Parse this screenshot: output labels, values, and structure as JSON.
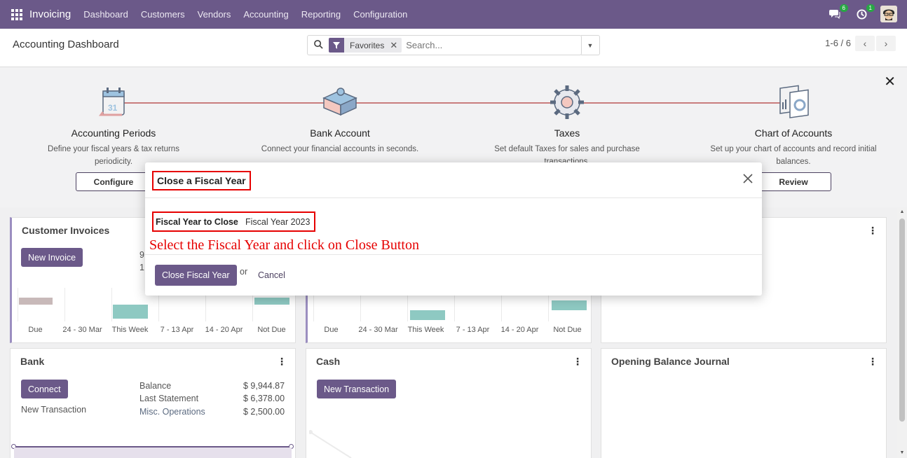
{
  "navbar": {
    "app_name": "Invoicing",
    "menu": [
      "Dashboard",
      "Customers",
      "Vendors",
      "Accounting",
      "Reporting",
      "Configuration"
    ],
    "messages_count": "6",
    "activities_count": "1"
  },
  "control": {
    "title": "Accounting Dashboard",
    "facet_label": "Favorites",
    "search_placeholder": "Search...",
    "pager": "1-6 / 6"
  },
  "onboarding": {
    "steps": [
      {
        "title": "Accounting Periods",
        "desc": "Define your fiscal years & tax returns periodicity.",
        "button": "Configure"
      },
      {
        "title": "Bank Account",
        "desc": "Connect your financial accounts in seconds."
      },
      {
        "title": "Taxes",
        "desc": "Set default Taxes for sales and purchase transactions."
      },
      {
        "title": "Chart of Accounts",
        "desc": "Set up your chart of accounts and record initial balances.",
        "button": "Review"
      }
    ]
  },
  "cards": {
    "customer_invoices": {
      "title": "Customer Invoices",
      "button": "New Invoice",
      "partial_digits": [
        "9",
        "1"
      ],
      "ticks": [
        "Due",
        "24 - 30 Mar",
        "This Week",
        "7 - 13 Apr",
        "14 - 20 Apr",
        "Not Due"
      ]
    },
    "vendor_bills": {
      "ticks": [
        "Due",
        "24 - 30 Mar",
        "This Week",
        "7 - 13 Apr",
        "14 - 20 Apr",
        "Not Due"
      ]
    },
    "bank": {
      "title": "Bank",
      "button": "Connect",
      "link": "New Transaction",
      "stats": [
        {
          "label": "Balance",
          "value": "$ 9,944.87"
        },
        {
          "label": "Last Statement",
          "value": "$ 6,378.00"
        },
        {
          "label": "Misc. Operations",
          "value": "$ 2,500.00"
        }
      ]
    },
    "cash": {
      "title": "Cash",
      "button": "New Transaction"
    },
    "opening": {
      "title": "Opening Balance Journal"
    }
  },
  "modal": {
    "title": "Close a Fiscal Year",
    "field_label": "Fiscal Year to Close",
    "field_value": "Fiscal Year 2023",
    "instruction": "Select the Fiscal Year and click on Close Button",
    "primary_button": "Close Fiscal Year",
    "or_text": "or",
    "cancel": "Cancel"
  },
  "colors": {
    "brand": "#6b5989",
    "annotation_red": "#e60000",
    "bar_teal": "#8ec9c2",
    "bar_past": "#c8b9b9"
  }
}
